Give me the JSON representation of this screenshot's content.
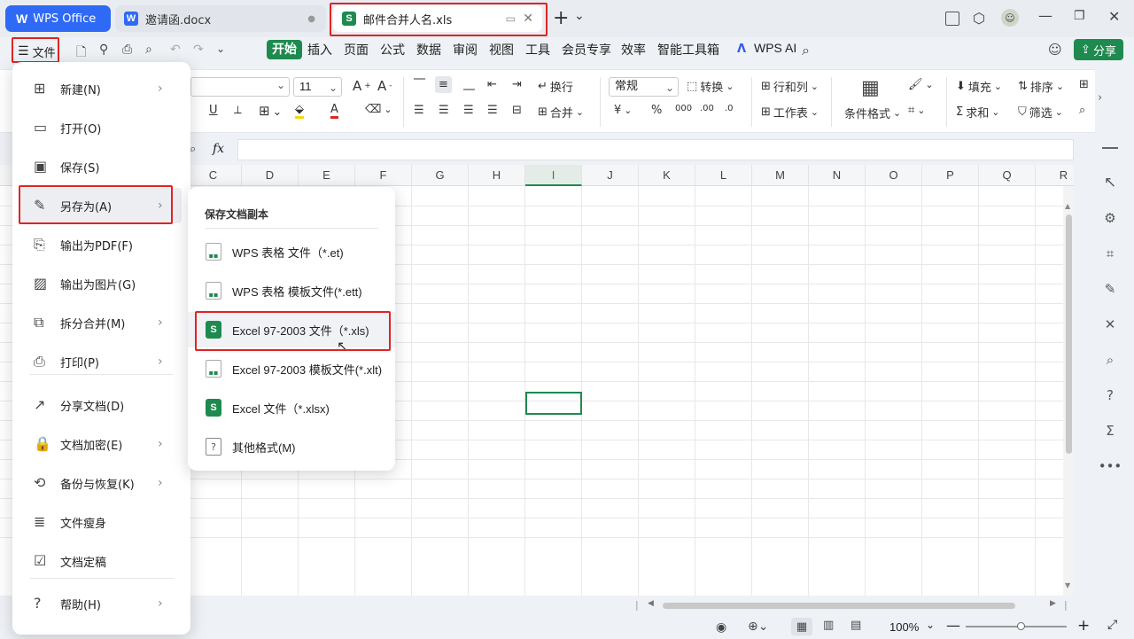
{
  "titlebar": {
    "tabs": [
      {
        "label": "WPS Office",
        "icon": "wps-logo-icon"
      },
      {
        "label": "邀请函.docx",
        "icon": "writer-doc-icon"
      },
      {
        "label": "邮件合并人名.xls",
        "icon": "spreadsheet-icon"
      }
    ],
    "new_tab": "+",
    "more": "⌄"
  },
  "menubar": {
    "file_label": "文件",
    "tabs": [
      "开始",
      "插入",
      "页面",
      "公式",
      "数据",
      "审阅",
      "视图",
      "工具",
      "会员专享",
      "效率",
      "智能工具箱"
    ],
    "ai_label": "WPS AI",
    "share_label": "分享"
  },
  "ribbon": {
    "font_size": "11",
    "wrap_label": "换行",
    "merge_label": "合并",
    "number_format": "常规",
    "convert_label": "转换",
    "rowcol_label": "行和列",
    "sheet_label": "工作表",
    "cond_format_label": "条件格式",
    "fill_label": "填充",
    "sort_label": "排序",
    "sum_label": "求和",
    "filter_label": "筛选",
    "fx": "fx",
    "currency": "¥",
    "percent": "%"
  },
  "grid": {
    "columns": [
      "C",
      "D",
      "E",
      "F",
      "G",
      "H",
      "I",
      "J",
      "K",
      "L",
      "M",
      "N",
      "O",
      "P",
      "Q",
      "R"
    ],
    "selected_column": "I"
  },
  "file_menu": {
    "items": [
      {
        "label": "新建(N)",
        "arrow": true
      },
      {
        "label": "打开(O)",
        "arrow": false
      },
      {
        "label": "保存(S)",
        "arrow": false
      },
      {
        "label": "另存为(A)",
        "arrow": true
      },
      {
        "label": "输出为PDF(F)",
        "arrow": false
      },
      {
        "label": "输出为图片(G)",
        "arrow": false
      },
      {
        "label": "拆分合并(M)",
        "arrow": true
      },
      {
        "label": "打印(P)",
        "arrow": true
      },
      {
        "label": "分享文档(D)",
        "arrow": false
      },
      {
        "label": "文档加密(E)",
        "arrow": true
      },
      {
        "label": "备份与恢复(K)",
        "arrow": true
      },
      {
        "label": "文件瘦身",
        "arrow": false
      },
      {
        "label": "文档定稿",
        "arrow": false
      },
      {
        "label": "帮助(H)",
        "arrow": true
      }
    ]
  },
  "save_as_submenu": {
    "title": "保存文档副本",
    "items": [
      {
        "label": "WPS 表格 文件（*.et)",
        "icon": "et-file-icon"
      },
      {
        "label": "WPS 表格 模板文件(*.ett)",
        "icon": "ett-file-icon"
      },
      {
        "label": "Excel 97-2003 文件（*.xls)",
        "icon": "xls-file-icon"
      },
      {
        "label": "Excel 97-2003 模板文件(*.xlt)",
        "icon": "xlt-file-icon"
      },
      {
        "label": "Excel 文件（*.xlsx)",
        "icon": "xlsx-file-icon"
      },
      {
        "label": "其他格式(M)",
        "icon": "other-format-icon"
      }
    ]
  },
  "statusbar": {
    "zoom": "100%"
  },
  "colors": {
    "accent_green": "#1e8a4f",
    "highlight_red": "#e02424",
    "wps_blue": "#2f6af6",
    "writer_blue": "#2f6af6"
  }
}
